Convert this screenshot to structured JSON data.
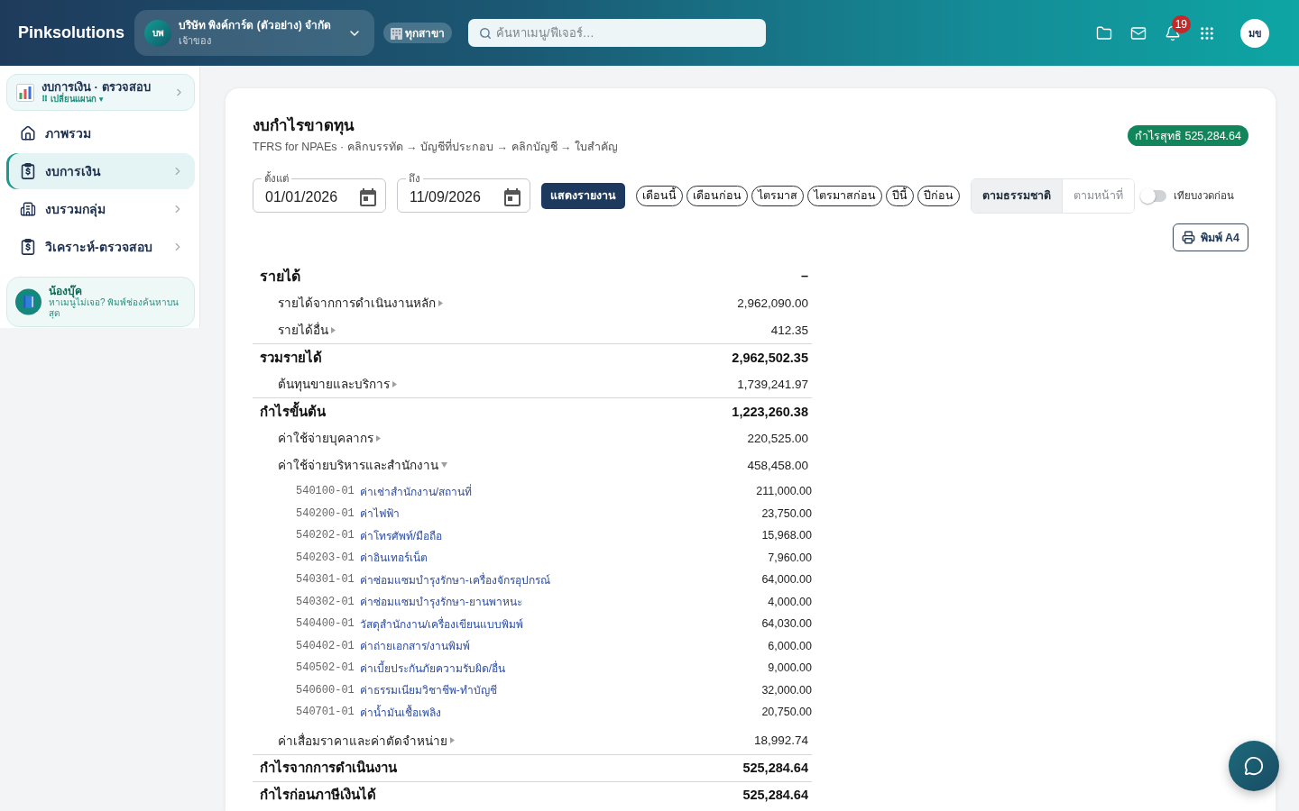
{
  "top_bar": {
    "logo": "Pinksolutions",
    "company": {
      "initials": "บพ",
      "name": "บริษัท พิงค์การ์ด (ตัวอย่าง) จำกัด",
      "role": "เจ้าของ"
    },
    "branch": "ทุกสาขา",
    "search": {
      "placeholder": "ค้นหาเมนู/ฟีเจอร์…"
    },
    "notification_count": "19",
    "user_initials": "มข"
  },
  "sidebar": {
    "plan": {
      "title": "งบการเงิน · ตรวจสอบ",
      "switch_label": "⠿ เปลี่ยนแผนก ▾"
    },
    "items": [
      {
        "label": "ภาพรวม",
        "selected": false,
        "has_submenu": false
      },
      {
        "label": "งบการเงิน",
        "selected": true,
        "has_submenu": true
      },
      {
        "label": "งบรวมกลุ่ม",
        "selected": false,
        "has_submenu": true
      },
      {
        "label": "วิเคราะห์-ตรวจสอบ",
        "selected": false,
        "has_submenu": true
      }
    ],
    "helper": {
      "title": "น้องบุ๊ค",
      "text": "หาเมนูไม่เจอ? พิมพ์ช่องค้นหาบนสุด"
    }
  },
  "report": {
    "title": "งบกำไรขาดทุน",
    "subtitle": "TFRS for NPAEs · คลิกบรรทัด → บัญชีที่ประกอบ → คลิกบัญชี → ใบสำคัญ",
    "net_profit": "กำไรสุทธิ 525,284.64",
    "filters": {
      "date_from": {
        "label": "ตั้งแต่",
        "value": "01/01/2026"
      },
      "date_to": {
        "label": "ถึง",
        "value": "11/09/2026"
      },
      "show_button": "แสดงรายงาน",
      "presets": [
        "เดือนนี้",
        "เดือนก่อน",
        "ไตรมาส",
        "ไตรมาสก่อน",
        "ปีนี้",
        "ปีก่อน"
      ],
      "views": [
        {
          "label": "ตามธรรมชาติ",
          "selected": true
        },
        {
          "label": "ตามหน้าที่",
          "selected": false
        }
      ],
      "compare": {
        "label": "เทียบงวดก่อน",
        "on": false
      }
    },
    "print_button": "พิมพ์ A4",
    "rows": [
      {
        "kind": "heading",
        "label": "รายได้",
        "amount": "–"
      },
      {
        "kind": "line",
        "label": "รายได้จากการดำเนินงานหลัก",
        "amount": "2,962,090.00",
        "expanded": false
      },
      {
        "kind": "line",
        "label": "รายได้อื่น",
        "amount": "412.35",
        "expanded": false
      },
      {
        "kind": "total",
        "label": "รวมรายได้",
        "amount": "2,962,502.35"
      },
      {
        "kind": "line",
        "label": "ต้นทุนขายและบริการ",
        "amount": "1,739,241.97",
        "expanded": false
      },
      {
        "kind": "total",
        "label": "กำไรขั้นต้น",
        "amount": "1,223,260.38"
      },
      {
        "kind": "line",
        "label": "ค่าใช้จ่ายบุคลากร",
        "amount": "220,525.00",
        "expanded": false
      },
      {
        "kind": "line",
        "label": "ค่าใช้จ่ายบริหารและสำนักงาน",
        "amount": "458,458.00",
        "expanded": true,
        "children": [
          {
            "code": "540100-01",
            "name": "ค่าเช่าสำนักงาน/สถานที่",
            "amount": "211,000.00"
          },
          {
            "code": "540200-01",
            "name": "ค่าไฟฟ้า",
            "amount": "23,750.00"
          },
          {
            "code": "540202-01",
            "name": "ค่าโทรศัพท์/มือถือ",
            "amount": "15,968.00"
          },
          {
            "code": "540203-01",
            "name": "ค่าอินเทอร์เน็ต",
            "amount": "7,960.00"
          },
          {
            "code": "540301-01",
            "name": "ค่าซ่อมแซมบำรุงรักษา-เครื่องจักรอุปกรณ์",
            "amount": "64,000.00"
          },
          {
            "code": "540302-01",
            "name": "ค่าซ่อมแซมบำรุงรักษา-ยานพาหนะ",
            "amount": "4,000.00"
          },
          {
            "code": "540400-01",
            "name": "วัสดุสำนักงาน/เครื่องเขียนแบบพิมพ์",
            "amount": "64,030.00"
          },
          {
            "code": "540402-01",
            "name": "ค่าถ่ายเอกสาร/งานพิมพ์",
            "amount": "6,000.00"
          },
          {
            "code": "540502-01",
            "name": "ค่าเบี้ยประกันภัยความรับผิด/อื่น",
            "amount": "9,000.00"
          },
          {
            "code": "540600-01",
            "name": "ค่าธรรมเนียมวิชาชีพ-ทำบัญชี",
            "amount": "32,000.00"
          },
          {
            "code": "540701-01",
            "name": "ค่าน้ำมันเชื้อเพลิง",
            "amount": "20,750.00"
          }
        ]
      },
      {
        "kind": "line",
        "label": "ค่าเสื่อมราคาและค่าตัดจำหน่าย",
        "amount": "18,992.74",
        "expanded": false
      },
      {
        "kind": "total",
        "label": "กำไรจากการดำเนินงาน",
        "amount": "525,284.64"
      },
      {
        "kind": "total",
        "label": "กำไรก่อนภาษีเงินได้",
        "amount": "525,284.64"
      }
    ]
  }
}
